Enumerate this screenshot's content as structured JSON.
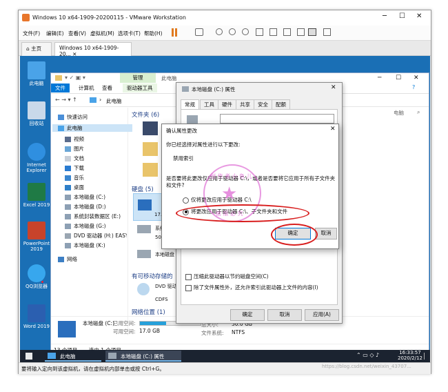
{
  "vmware": {
    "title": "Windows 10 x64-1909-20200115 - VMware Workstation",
    "menu": [
      "文件(F)",
      "编辑(E)",
      "查看(V)",
      "虚拟机(M)",
      "选项卡(T)",
      "帮助(H)"
    ],
    "tabs": [
      "主页",
      "Windows 10 x64-1909-20..."
    ],
    "statusbar": "要将输入定向到该虚拟机，请在虚拟机内部单击或按 Ctrl+G。"
  },
  "desktop": {
    "icons": [
      {
        "label": "此电脑",
        "icon": "computer-icon"
      },
      {
        "label": "回收站",
        "icon": "recycle-bin-icon"
      },
      {
        "label": "Internet Explorer",
        "icon": "ie-icon"
      },
      {
        "label": "Excel 2019",
        "icon": "excel-icon"
      },
      {
        "label": "PowerPoint 2019",
        "icon": "powerpoint-icon"
      },
      {
        "label": "QQ浏览器",
        "icon": "qq-browser-icon"
      },
      {
        "label": "Word 2019",
        "icon": "word-icon"
      }
    ]
  },
  "explorer": {
    "title": "此电脑",
    "ribbon_context": "管理",
    "ribbon_tabs": [
      "文件",
      "计算机",
      "查看",
      "驱动器工具"
    ],
    "address": "此电脑",
    "nav_items": [
      "快速访问",
      "此电脑",
      "视频",
      "图片",
      "文档",
      "下载",
      "音乐",
      "桌面",
      "本地磁盘 (C:)",
      "本地磁盘 (D:)",
      "系统封装数据区 (E:)",
      "本地磁盘 (G:)",
      "DVD 驱动器 (H:) EASYU",
      "本地磁盘 (K:)",
      "网络"
    ],
    "sections": {
      "folders": "文件夹 (6)",
      "drives": "硬盘 (5)",
      "removable": "有可移动存储的",
      "network": "网络位置 (1)"
    },
    "drive_partial": [
      "17.",
      "系统",
      "50.",
      "本地磁盘 (K:)"
    ],
    "dvd": {
      "name": "DVD 驱动器",
      "fs": "CDFS"
    },
    "side_text": "电脑",
    "details": {
      "name": "本地磁盘 (C:)",
      "used_label": "已用空间:",
      "free_label": "可用空间:",
      "free_value": "17.0 GB",
      "total_label": "总大小:",
      "total_value": "30.0 GB",
      "fs_label": "文件系统:",
      "fs_value": "NTFS"
    },
    "status_count": "13 个项目",
    "status_selected": "选中 1 个项目"
  },
  "properties": {
    "title": "本地磁盘 (C:) 属性",
    "tabs": [
      "常规",
      "工具",
      "硬件",
      "共享",
      "安全",
      "配额"
    ],
    "checkbox_compress": "压缩此驱动器以节约磁盘空间(C)",
    "checkbox_index": "除了文件属性外，还允许索引此驱动器上文件的内容(I)",
    "buttons": [
      "确定",
      "取消",
      "应用(A)"
    ]
  },
  "confirm": {
    "title": "确认属性更改",
    "line1": "你已经选择对属性进行以下更改:",
    "change": "禁用索引",
    "question": "是否要将此更改仅应用于驱动器 C:\\，或者是否要将它应用于所有子文件夹和文件?",
    "option1": "仅将更改应用于驱动器 C:\\",
    "option2": "将更改应用于驱动器 C:\\、子文件夹和文件",
    "ok": "确定",
    "cancel": "取消"
  },
  "watermark": {
    "top": "创 作 者 小 鱼 儿",
    "bottom": "偷 版 必 究"
  },
  "taskbar": {
    "items": [
      "此电脑",
      "本地磁盘 (C:) 属性"
    ],
    "time": "16:33:57",
    "date": "2020/2/12"
  },
  "footer_watermark": "https://blog.csdn.net/weixin_43707...",
  "colors": {
    "accent": "#0078d7",
    "annotation_red": "#d81e1e",
    "desktop_blue": "#1a6fb5",
    "ribbon_green": "#d8efd0"
  }
}
